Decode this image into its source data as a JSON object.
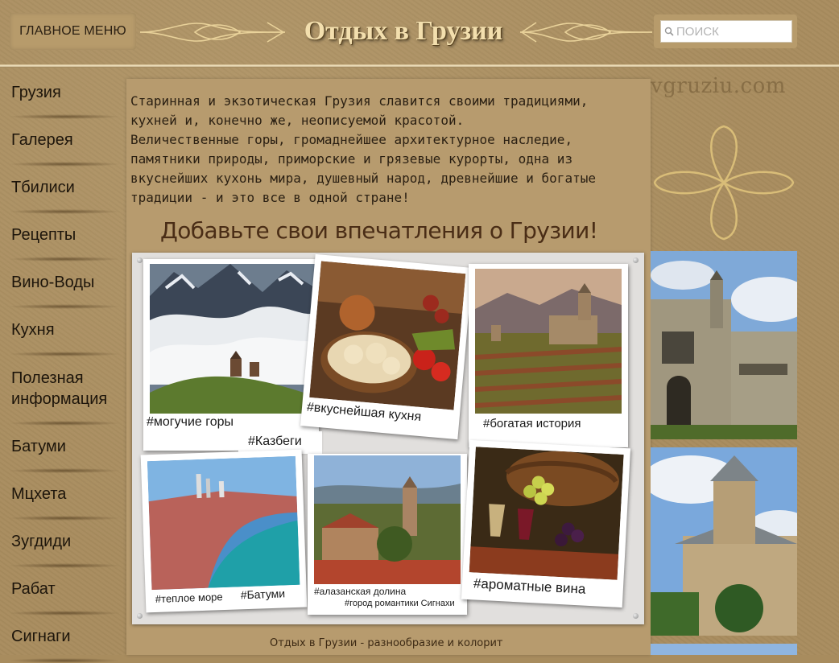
{
  "header": {
    "menu_label": "ГЛАВНОЕ МЕНЮ",
    "site_title": "Отдых в Грузии",
    "search_placeholder": "ПОИСК",
    "watermark": "vgruziu.com"
  },
  "sidebar": {
    "items": [
      {
        "label": "Грузия"
      },
      {
        "label": "Галерея"
      },
      {
        "label": "Тбилиси"
      },
      {
        "label": "Рецепты"
      },
      {
        "label": "Вино-Воды"
      },
      {
        "label": "Кухня"
      },
      {
        "label": "Полезная информация"
      },
      {
        "label": "Батуми"
      },
      {
        "label": "Мцхета"
      },
      {
        "label": "Зугдиди"
      },
      {
        "label": "Рабат"
      },
      {
        "label": "Сигнаги"
      }
    ]
  },
  "main": {
    "intro_text": "Старинная и экзотическая Грузия славится своими традициями,\nкухней и, конечно же, неописуемой красотой.\nВеличественные горы, громаднейшее архитектурное наследие,\nпамятники природы, приморские и грязевые курорты, одна из\nвкуснейших кухонь мира, душевный народ, древнейшие и богатые\nтрадиции - и это все в одной стране!",
    "heading": "Добавьте свои впечатления о Грузии!",
    "collage": {
      "captions": {
        "mountains": "#могучие горы",
        "kazbegi": "#Казбеги",
        "cuisine": "#вкуснейшая кухня",
        "history": "#богатая история",
        "sea": "#теплое море",
        "batumi": "#Батуми",
        "valley": "#алазанская долина",
        "sighnaghi": "#город романтики Сигнахи",
        "wines": "#ароматные вина"
      }
    },
    "footer_text": "Отдых в Грузии - разнообразие и колорит"
  },
  "colors": {
    "background": "#a88c5e",
    "panel": "#b79b6e",
    "title": "#f3dfae",
    "heading": "#4a2d16",
    "text": "#2b2013"
  }
}
